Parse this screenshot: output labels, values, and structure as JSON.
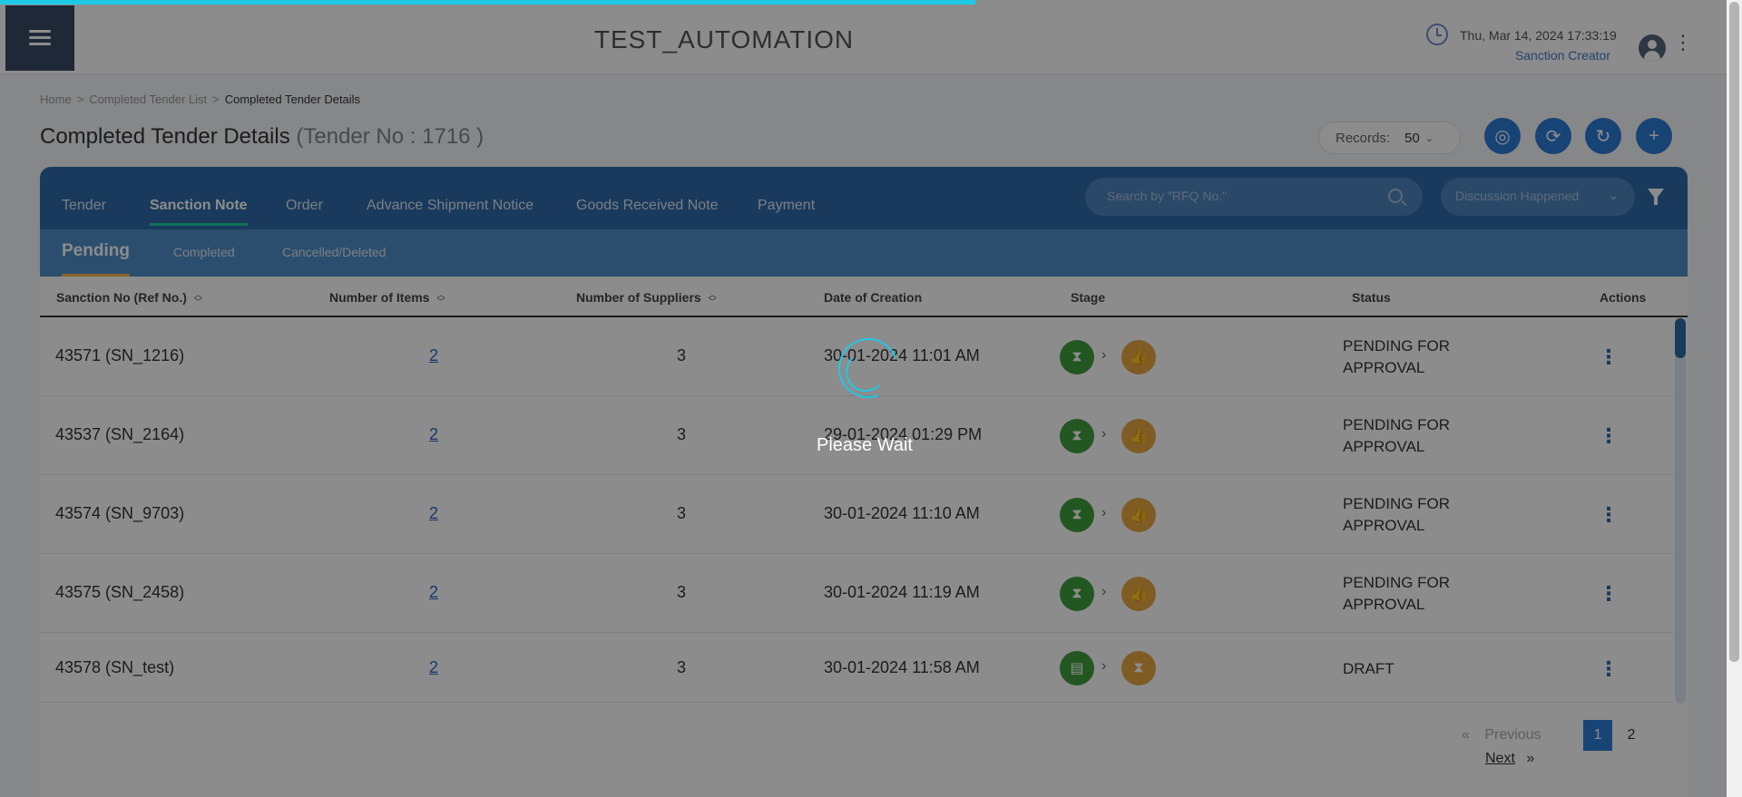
{
  "header": {
    "app_title": "TEST_AUTOMATION",
    "datetime": "Thu, Mar 14, 2024 17:33:19",
    "role": "Sanction Creator"
  },
  "breadcrumb": {
    "items": [
      "Home",
      "Completed Tender List",
      "Completed Tender Details"
    ]
  },
  "page": {
    "title": "Completed Tender Details",
    "subtitle": "(Tender No : 1716 )"
  },
  "toolbar": {
    "records_label": "Records:",
    "records_value": "50",
    "accent_color": "#2d7bd6"
  },
  "tabs": [
    "Tender",
    "Sanction Note",
    "Order",
    "Advance Shipment Notice",
    "Goods Received Note",
    "Payment"
  ],
  "active_tab": "Sanction Note",
  "search": {
    "placeholder": "Search by \"RFQ No.\""
  },
  "filter": {
    "selected": "Discussion Happened"
  },
  "subtabs": [
    "Pending",
    "Completed",
    "Cancelled/Deleted"
  ],
  "active_subtab": "Pending",
  "table": {
    "columns": [
      "Sanction No (Ref No.)",
      "Number of Items",
      "Number of Suppliers",
      "Date of Creation",
      "Stage",
      "Status",
      "Actions"
    ],
    "rows": [
      {
        "sanction": "43571 (SN_1216)",
        "items": "2",
        "suppliers": "3",
        "date": "30-01-2024 11:01 AM",
        "status_line1": "PENDING FOR",
        "status_line2": "APPROVAL"
      },
      {
        "sanction": "43537 (SN_2164)",
        "items": "2",
        "suppliers": "3",
        "date": "29-01-2024 01:29 PM",
        "status_line1": "PENDING FOR",
        "status_line2": "APPROVAL"
      },
      {
        "sanction": "43574 (SN_9703)",
        "items": "2",
        "suppliers": "3",
        "date": "30-01-2024 11:10 AM",
        "status_line1": "PENDING FOR",
        "status_line2": "APPROVAL"
      },
      {
        "sanction": "43575 (SN_2458)",
        "items": "2",
        "suppliers": "3",
        "date": "30-01-2024 11:19 AM",
        "status_line1": "PENDING FOR",
        "status_line2": "APPROVAL"
      },
      {
        "sanction": "43578 (SN_test)",
        "items": "2",
        "suppliers": "3",
        "date": "30-01-2024 11:58 AM",
        "status_line1": "DRAFT",
        "status_line2": ""
      }
    ]
  },
  "pagination": {
    "first": "«",
    "previous": "Previous",
    "pages": [
      "1",
      "2"
    ],
    "current": "1",
    "next": "Next",
    "last": "»"
  },
  "loading": {
    "message": "Please Wait",
    "progress_percent": 56
  }
}
